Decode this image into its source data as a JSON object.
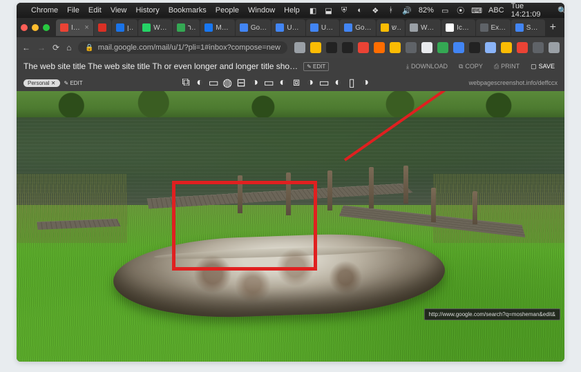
{
  "menubar": {
    "app": "Chrome",
    "items": [
      "File",
      "Edit",
      "View",
      "History",
      "Bookmarks",
      "People",
      "Window",
      "Help"
    ],
    "lang": "ABC",
    "clock": "Tue 14:21:09",
    "battery_pct": "82%"
  },
  "tabs": [
    {
      "label": "Inbox",
      "favColor": "#ea4335",
      "active": true,
      "closable": true
    },
    {
      "label": "",
      "favColor": "#d93025"
    },
    {
      "label": "יומן",
      "favColor": "#1a73e8"
    },
    {
      "label": "Whats",
      "favColor": "#25d366"
    },
    {
      "label": "ספר",
      "favColor": "#34a853"
    },
    {
      "label": "Messe",
      "favColor": "#1877f2"
    },
    {
      "label": "Google",
      "favColor": "#4285f4"
    },
    {
      "label": "Untitle",
      "favColor": "#4285f4"
    },
    {
      "label": "Untitle",
      "favColor": "#4285f4"
    },
    {
      "label": "Google",
      "favColor": "#4285f4"
    },
    {
      "label": "חדש",
      "favColor": "#fbbc04"
    },
    {
      "label": "Webpa",
      "favColor": "#9aa0a6"
    },
    {
      "label": "Icon S",
      "favColor": "#ffffff"
    },
    {
      "label": "Extens",
      "favColor": "#5f6368"
    },
    {
      "label": "Sandb",
      "favColor": "#4285f4"
    }
  ],
  "address": {
    "url": "mail.google.com/mail/u/1/?pli=1#inbox?compose=new"
  },
  "ext_colors": [
    "#9aa0a6",
    "#fbbc04",
    "#222",
    "#222",
    "#ea4335",
    "#ff6d00",
    "#fbbc04",
    "#5f6368",
    "#e8eaed",
    "#34a853",
    "#4285f4",
    "#222",
    "#8ab4f8",
    "#fbbc04",
    "#ea4335",
    "#5f6368",
    "#9aa0a6",
    "#202124",
    "#e8eaed"
  ],
  "capture": {
    "title": "The web site title The web site title Th or even longer and longer title sho…",
    "edit_btn": "✎ EDIT",
    "actions": {
      "download": "DOWNLOAD",
      "copy": "COPY",
      "print": "PRINT",
      "save": "SAVE"
    },
    "tag": "Personal",
    "tag_edit": "✎ EDIT",
    "footer_url": "webpagescreenshot.info/deffccx"
  },
  "tooltip_url": "http://www.google.com/search?q=mosheman&edit&",
  "colors": {
    "annotation": "#e02020"
  }
}
